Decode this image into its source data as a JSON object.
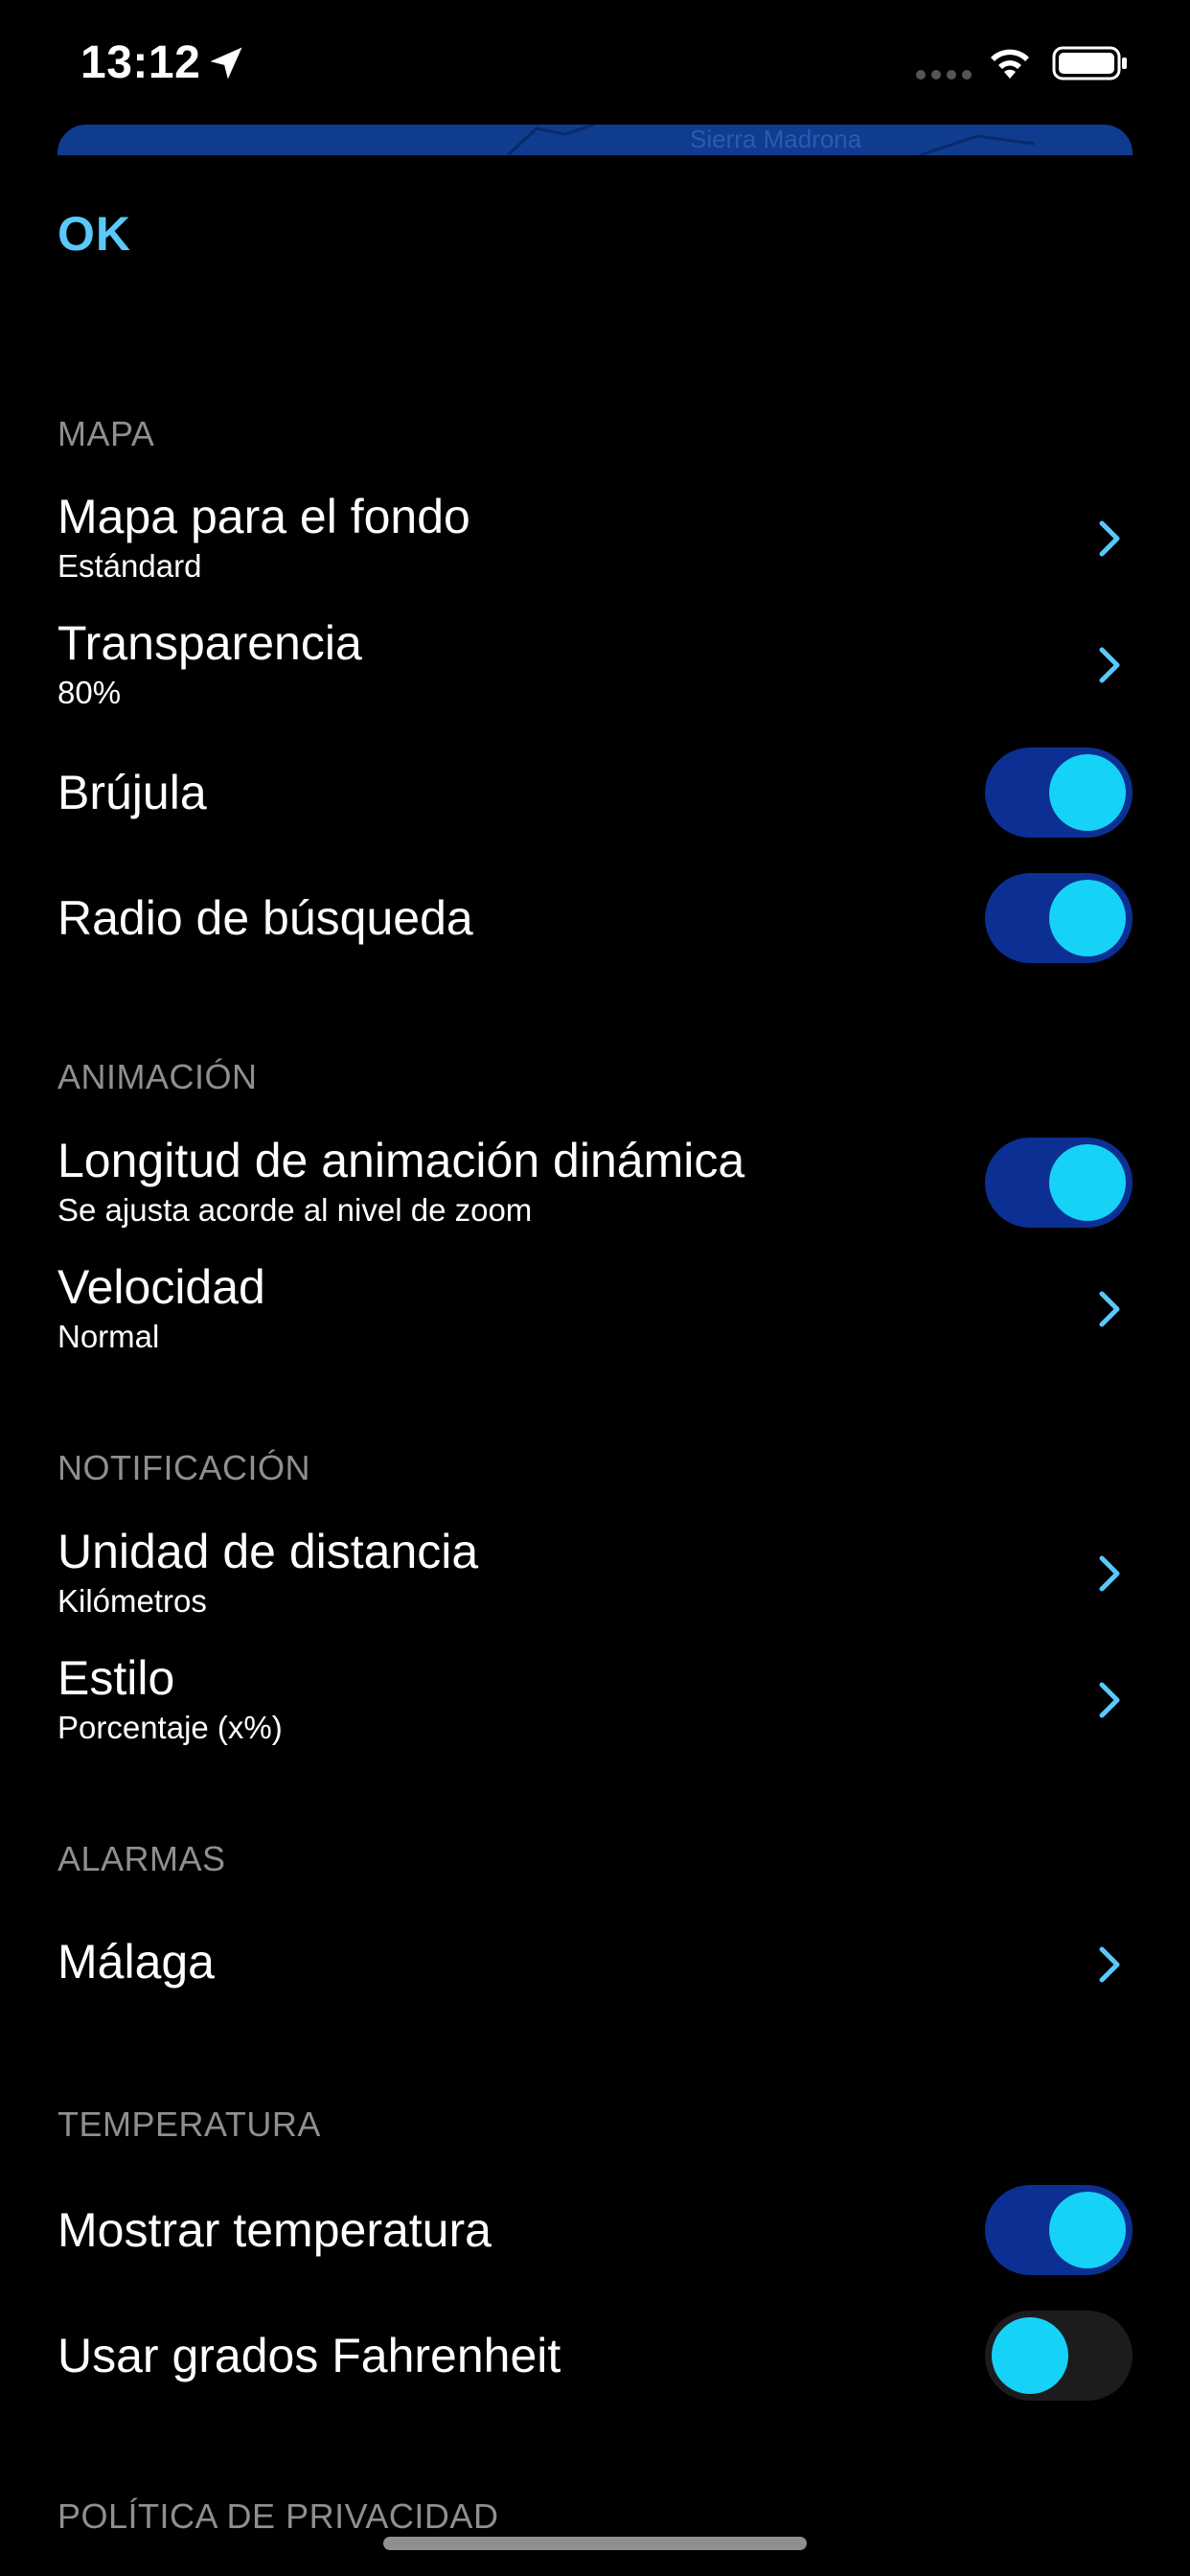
{
  "status_bar": {
    "time": "13:12"
  },
  "map_strip": {
    "label": "Sierra Madrona"
  },
  "ok_label": "OK",
  "sections": {
    "mapa": {
      "header": "MAPA",
      "fondo_title": "Mapa para el fondo",
      "fondo_value": "Estándard",
      "transparencia_title": "Transparencia",
      "transparencia_value": "80%",
      "brujula_title": "Brújula",
      "brujula_on": true,
      "radio_title": "Radio de búsqueda",
      "radio_on": true
    },
    "animacion": {
      "header": "ANIMACIÓN",
      "longitud_title": "Longitud de animación dinámica",
      "longitud_sub": "Se ajusta acorde al nivel de zoom",
      "longitud_on": true,
      "velocidad_title": "Velocidad",
      "velocidad_value": "Normal"
    },
    "notificacion": {
      "header": "NOTIFICACIÓN",
      "unidad_title": "Unidad de distancia",
      "unidad_value": "Kilómetros",
      "estilo_title": "Estilo",
      "estilo_value": "Porcentaje (x%)"
    },
    "alarmas": {
      "header": "ALARMAS",
      "malaga_title": "Málaga"
    },
    "temperatura": {
      "header": "TEMPERATURA",
      "mostrar_title": "Mostrar temperatura",
      "mostrar_on": true,
      "fahrenheit_title": "Usar grados Fahrenheit",
      "fahrenheit_on": false
    },
    "privacidad": {
      "header": "POLÍTICA DE PRIVACIDAD"
    }
  },
  "colors": {
    "accent": "#5ac8fa",
    "toggle_track_on": "#0c2f94",
    "toggle_knob": "#16d2f6",
    "section_header": "#8e8e93",
    "background": "#000000"
  },
  "icons": {
    "location": "location-arrow-icon",
    "wifi": "wifi-icon",
    "battery": "battery-icon",
    "chevron": "chevron-right-icon"
  }
}
